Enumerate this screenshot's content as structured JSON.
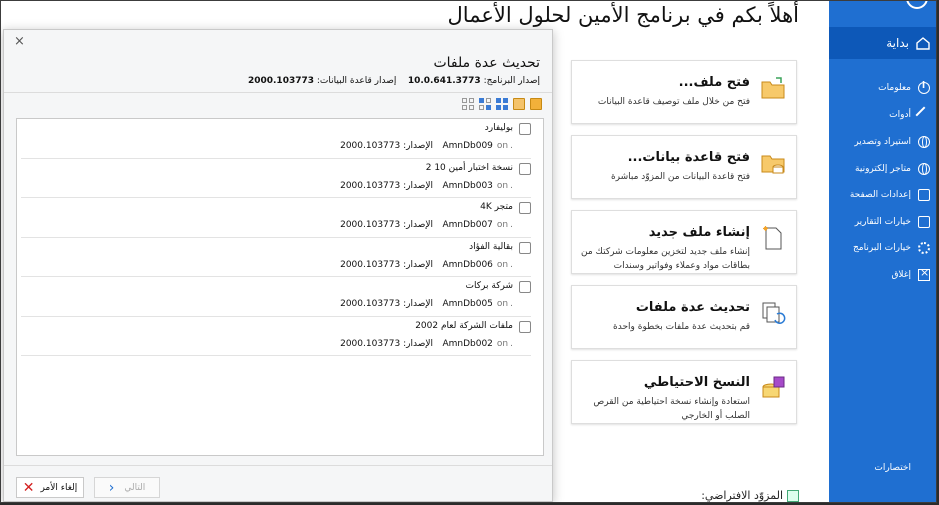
{
  "welcome": "أهلاً بكم في برنامج الأمين لحلول الأعمال",
  "cards": [
    {
      "icon": "folder-open-icon",
      "title": "فتح ملف...",
      "desc": "فتح من خلال ملف توصيف قاعدة البيانات"
    },
    {
      "icon": "folder-database-icon",
      "title": "فتح قاعدة بيانات...",
      "desc": "فتح قاعدة البيانات من المزوّد مباشرة"
    },
    {
      "icon": "new-file-icon",
      "title": "إنشاء ملف جديد",
      "desc": "إنشاء ملف جديد لتخزين معلومات شركتك من بطاقات مواد وعملاء وفواتير وسندات"
    },
    {
      "icon": "update-files-icon",
      "title": "تحديث عدة ملفات",
      "desc": "قم بتحديث عدة ملفات بخطوة واحدة"
    },
    {
      "icon": "backup-icon",
      "title": "النسخ الاحتياطي",
      "desc": "استعادة وإنشاء نسخة احتياطية من القرص الصلب أو الخارجي"
    }
  ],
  "default_provider": "المزوّد الافتراضي:",
  "sidebar": {
    "start": "بداية",
    "items": [
      {
        "label": "معلومات",
        "icon": "info-icon"
      },
      {
        "label": "أدوات",
        "icon": "tools-icon"
      },
      {
        "label": "استيراد وتصدير",
        "icon": "import-export-icon"
      },
      {
        "label": "متاجر إلكترونية",
        "icon": "globe-icon"
      },
      {
        "label": "إعدادات الصفحة",
        "icon": "page-settings-icon"
      },
      {
        "label": "خيارات التقارير",
        "icon": "report-options-icon"
      },
      {
        "label": "خيارات البرنامج",
        "icon": "gear-icon"
      },
      {
        "label": "إغلاق",
        "icon": "exit-icon"
      }
    ],
    "shortcuts": "اختصارات"
  },
  "dialog": {
    "close": "×",
    "title": "تحديث عدة ملفات",
    "program_version_label": "إصدار البرنامج:",
    "program_version": "10.0.641.3773",
    "db_version_label": "إصدار قاعدة البيانات:",
    "db_version": "2000.103773",
    "rows": [
      {
        "name": "بوليفارد",
        "code": "AmnDb009",
        "on": "on",
        "version_label": "الإصدار:",
        "version": "2000.103773"
      },
      {
        "name": "نسخة اختبار أمين 10 2",
        "code": "AmnDb003",
        "on": "on",
        "version_label": "الإصدار:",
        "version": "2000.103773"
      },
      {
        "name": "متجر 4K",
        "code": "AmnDb007",
        "on": "on",
        "version_label": "الإصدار:",
        "version": "2000.103773"
      },
      {
        "name": "بقالية الفؤاد",
        "code": "AmnDb006",
        "on": "on",
        "version_label": "الإصدار:",
        "version": "2000.103773"
      },
      {
        "name": "شركة بركات",
        "code": "AmnDb005",
        "on": "on",
        "version_label": "الإصدار:",
        "version": "2000.103773"
      },
      {
        "name": "ملفات الشركة لعام  2002",
        "code": "AmnDb002",
        "on": "on",
        "version_label": "الإصدار:",
        "version": "2000.103773"
      }
    ],
    "cancel": "إلغاء الأمر",
    "next": "التالي"
  }
}
